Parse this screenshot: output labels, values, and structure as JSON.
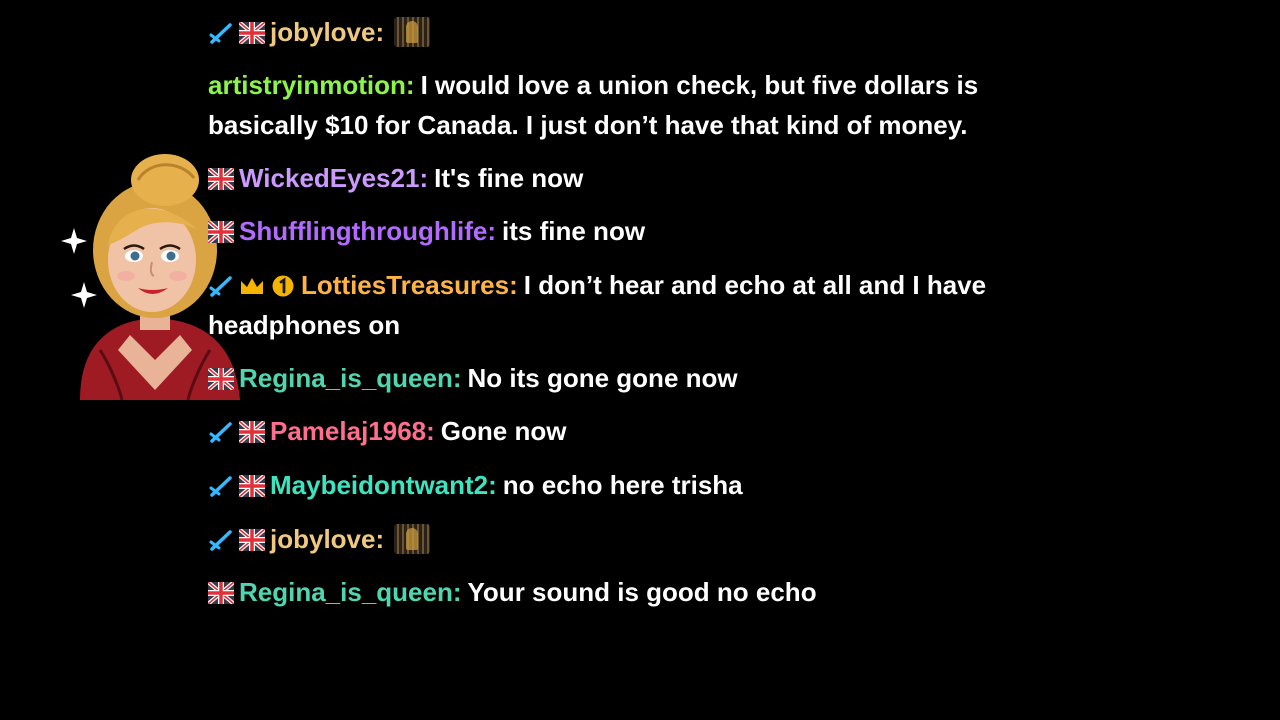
{
  "colors": {
    "background": "#000000",
    "message_text": "#ffffff"
  },
  "chat": {
    "messages": [
      {
        "user": "jobylove:",
        "color": "#f0c980",
        "badges": [
          "sword-icon",
          "uk-flag-icon"
        ],
        "text": "",
        "emote": "lurk-emote"
      },
      {
        "user": "artistryinmotion:",
        "color": "#8cf54a",
        "badges": [],
        "text": "I would love a union check, but five dollars is basically $10 for Canada. I just don’t have that kind of money."
      },
      {
        "user": "WickedEyes21:",
        "color": "#cc99ff",
        "badges": [
          "uk-flag-icon"
        ],
        "text": "It's fine now"
      },
      {
        "user": "Shufflingthroughlife:",
        "color": "#b36bff",
        "badges": [
          "uk-flag-icon"
        ],
        "text": "its fine now"
      },
      {
        "user": "LottiesTreasures:",
        "color": "#ffb347",
        "badges": [
          "sword-icon",
          "crown-icon",
          "number-one-icon"
        ],
        "text": "I don’t hear and echo at all and I have headphones on"
      },
      {
        "user": "Regina_is_queen:",
        "color": "#4fd6b0",
        "badges": [
          "uk-flag-icon"
        ],
        "text": "No its gone gone now"
      },
      {
        "user": "Pamelaj1968:",
        "color": "#ff6e8a",
        "badges": [
          "sword-icon",
          "uk-flag-icon"
        ],
        "text": "Gone now"
      },
      {
        "user": "Maybeidontwant2:",
        "color": "#3ee3c0",
        "badges": [
          "sword-icon",
          "uk-flag-icon"
        ],
        "text": "no echo here trisha"
      },
      {
        "user": "jobylove:",
        "color": "#f0c980",
        "badges": [
          "sword-icon",
          "uk-flag-icon"
        ],
        "text": "",
        "emote": "lurk-emote"
      },
      {
        "user": "Regina_is_queen:",
        "color": "#4fd6b0",
        "badges": [
          "uk-flag-icon"
        ],
        "text": "Your sound is good no echo"
      }
    ]
  }
}
